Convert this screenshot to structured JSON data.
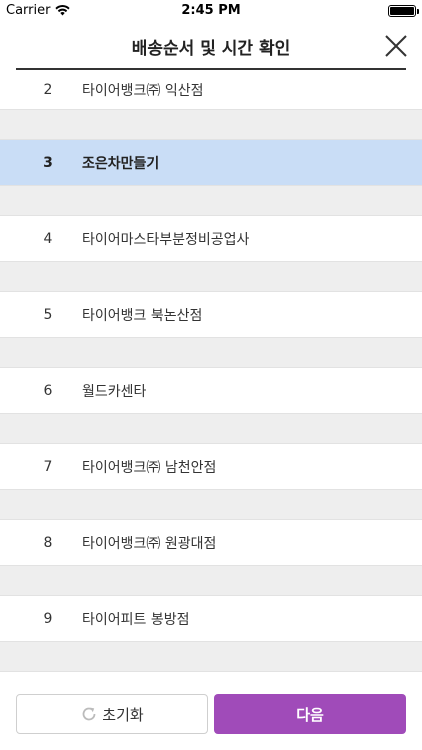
{
  "status_bar": {
    "carrier": "Carrier",
    "time": "2:45 PM"
  },
  "header": {
    "title": "배송순서 및 시간 확인"
  },
  "list": {
    "items": [
      {
        "num": "2",
        "name": "타이어뱅크㈜ 익산점"
      },
      {
        "num": "3",
        "name": "조은차만들기"
      },
      {
        "num": "4",
        "name": "타이어마스타부분정비공업사"
      },
      {
        "num": "5",
        "name": "타이어뱅크 북논산점"
      },
      {
        "num": "6",
        "name": "월드카센타"
      },
      {
        "num": "7",
        "name": "타이어뱅크㈜ 남천안점"
      },
      {
        "num": "8",
        "name": "타이어뱅크㈜ 원광대점"
      },
      {
        "num": "9",
        "name": "타이어피트 봉방점"
      }
    ],
    "selected_num": "3"
  },
  "buttons": {
    "reset_label": "초기화",
    "next_label": "다음"
  },
  "colors": {
    "accent": "#a04bb9",
    "selected_row": "#c9ddf6",
    "gap_row": "#eeeeee"
  },
  "icons": {
    "reset": "refresh-icon",
    "close": "close-icon",
    "wifi": "wifi-icon",
    "battery": "battery-icon"
  }
}
